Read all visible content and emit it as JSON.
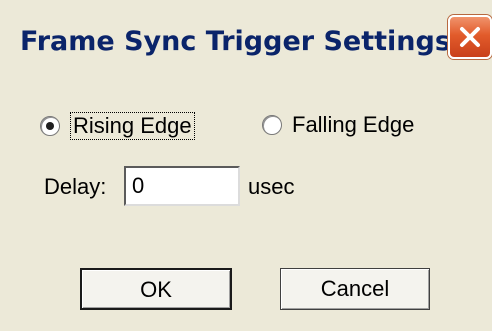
{
  "window": {
    "title": "Frame Sync Trigger Settings"
  },
  "icons": {
    "close": "close-icon"
  },
  "colors": {
    "title_text": "#0a246a",
    "dialog_background": "#ece9d8",
    "close_button": "#e25b2b"
  },
  "trigger": {
    "rising_label": "Rising Edge",
    "falling_label": "Falling Edge",
    "selected": "Rising Edge"
  },
  "delay": {
    "label": "Delay:",
    "value": "0",
    "unit": "usec"
  },
  "buttons": {
    "ok_label": "OK",
    "cancel_label": "Cancel"
  }
}
